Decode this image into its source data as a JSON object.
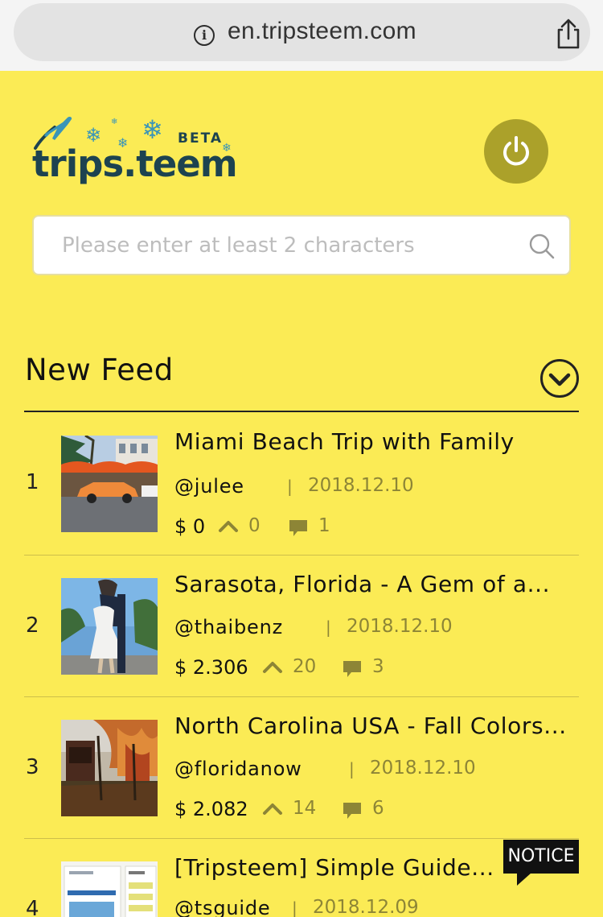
{
  "browser": {
    "url": "en.tripsteem.com"
  },
  "header": {
    "logo_text": "trips.teem",
    "logo_badge": "BETA"
  },
  "search": {
    "placeholder": "Please enter at least 2 characters"
  },
  "feed": {
    "title": "New Feed",
    "items": [
      {
        "rank": "1",
        "title": "Miami Beach Trip with Family",
        "author": "@julee",
        "date": "2018.12.10",
        "payout": "$ 0",
        "votes": "0",
        "comments": "1"
      },
      {
        "rank": "2",
        "title": "Sarasota, Florida - A Gem of a...",
        "author": "@thaibenz",
        "date": "2018.12.10",
        "payout": "$ 2.306",
        "votes": "20",
        "comments": "3"
      },
      {
        "rank": "3",
        "title": "North Carolina USA - Fall Colors...",
        "author": "@floridanow",
        "date": "2018.12.10",
        "payout": "$ 2.082",
        "votes": "14",
        "comments": "6"
      },
      {
        "rank": "4",
        "title": "[Tripsteem] Simple Guide...",
        "author": "@tsguide",
        "date": "2018.12.09",
        "payout": "",
        "votes": "",
        "comments": ""
      }
    ]
  },
  "notice": {
    "label": "NOTICE"
  },
  "colors": {
    "background": "#fbeb55",
    "accent": "#aba12a",
    "muted": "#8d8536",
    "logo": "#1d4350"
  }
}
